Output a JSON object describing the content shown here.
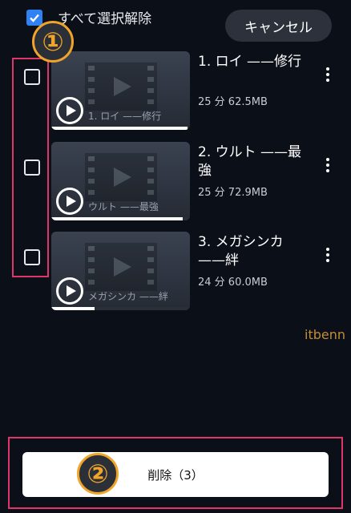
{
  "header": {
    "select_all_label": "すべて選択解除",
    "select_all_checked": true,
    "cancel_label": "キャンセル"
  },
  "annotations": {
    "badge_1": "①",
    "badge_2": "②",
    "highlight_color": "#e0346b",
    "badge_color": "#f0a52a"
  },
  "videos": [
    {
      "title": "1. ロイ ——修行",
      "meta": "25 分 62.5MB",
      "thumb_caption": "1. ロイ ——修行",
      "checked": false,
      "progress": 0.98
    },
    {
      "title": "2. ウルト ——最強",
      "meta": "25 分 72.9MB",
      "thumb_caption": "ウルト ——最強",
      "checked": false,
      "progress": 0.95
    },
    {
      "title": "3. メガシンカ——絆",
      "meta": "24 分 60.0MB",
      "thumb_caption": "メガシンカ ——絆",
      "checked": false,
      "progress": 0.31
    }
  ],
  "watermark": "itbenn",
  "footer": {
    "delete_label": "削除（3）"
  },
  "colors": {
    "background": "#0b0f18",
    "accent": "#2f82f3"
  },
  "icons": [
    "check-icon",
    "play-icon",
    "film-icon",
    "more-vertical-icon"
  ]
}
